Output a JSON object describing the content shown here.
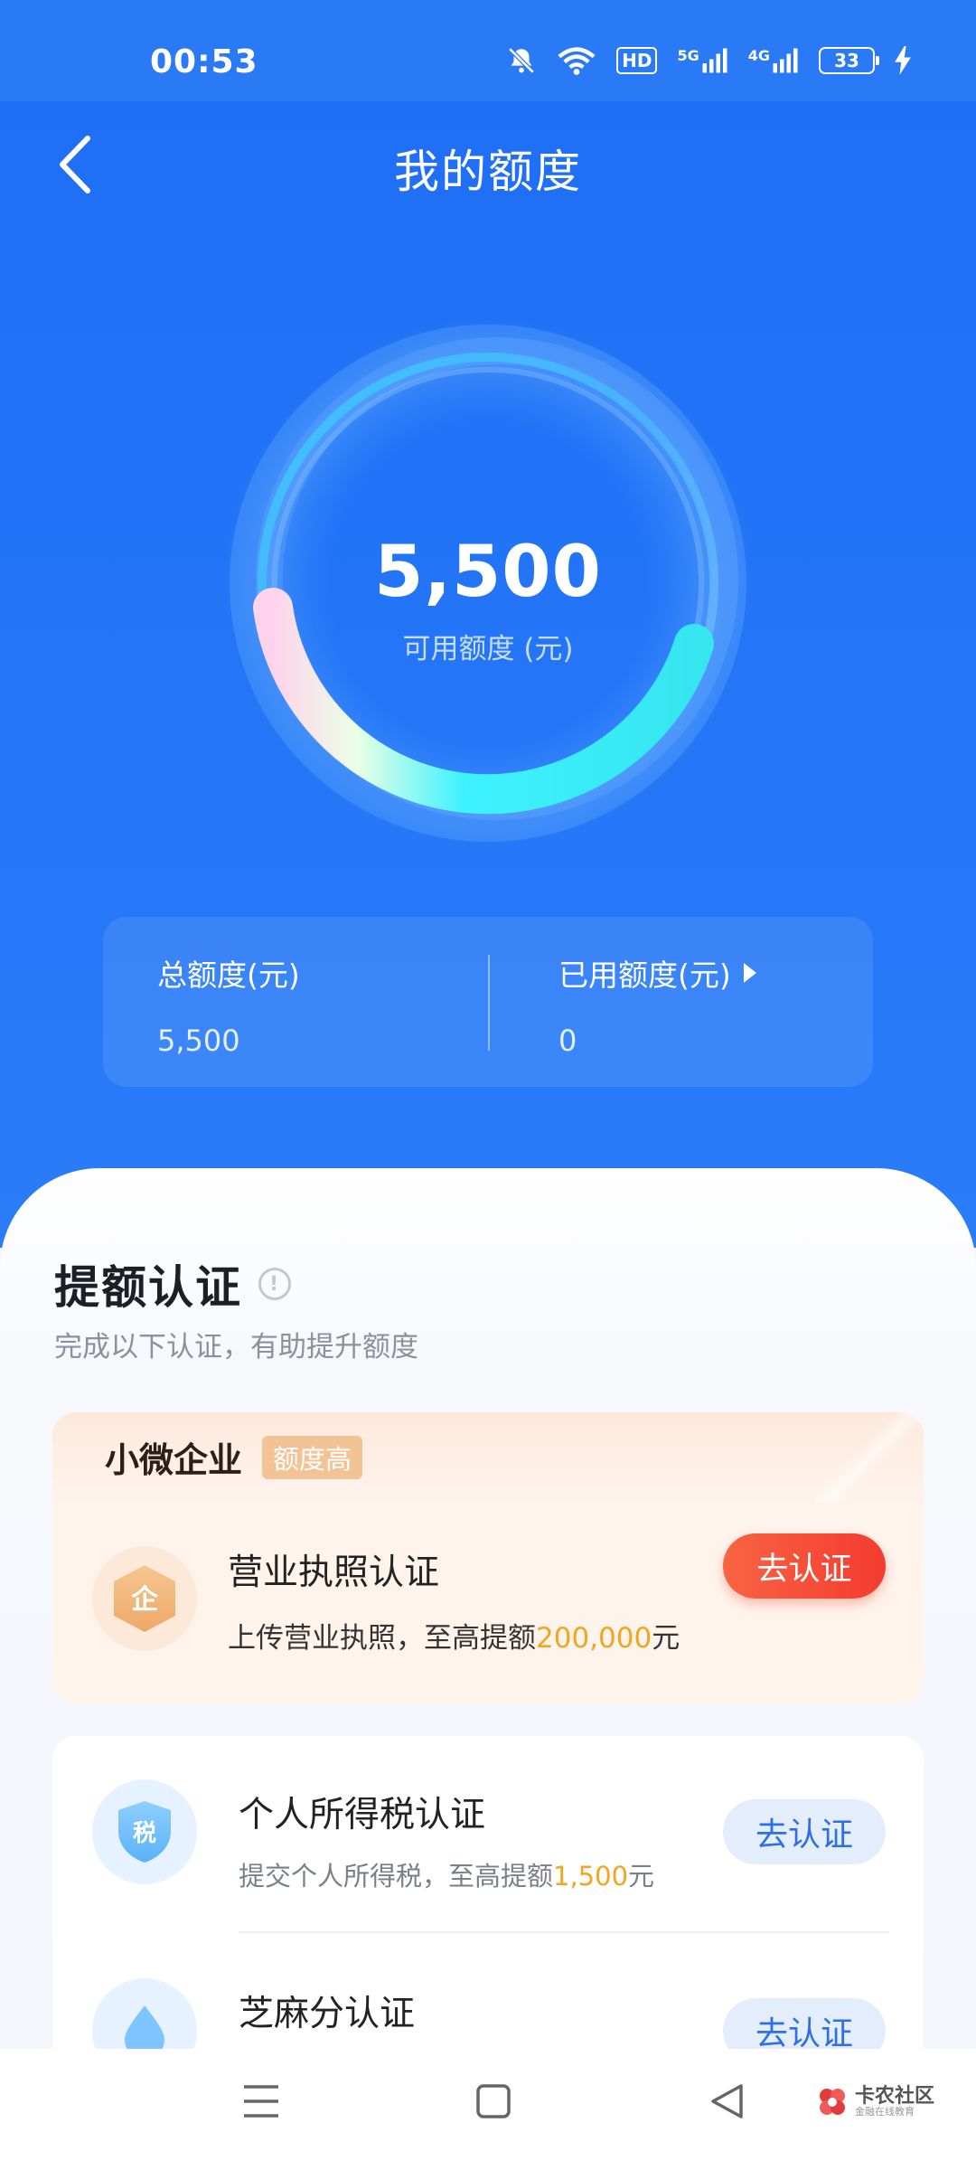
{
  "status_bar": {
    "time": "00:53",
    "hd_label": "HD",
    "sim1_label": "5G",
    "sim2_label": "4G",
    "battery": "33"
  },
  "header": {
    "title": "我的额度"
  },
  "ring": {
    "amount": "5,500",
    "caption": "可用额度 (元)"
  },
  "summary": {
    "total_label": "总额度(元)",
    "total_value": "5,500",
    "used_label": "已用额度(元)",
    "used_value": "0"
  },
  "certification": {
    "title": "提额认证",
    "subtitle": "完成以下认证，有助提升额度",
    "biz_section": {
      "title": "小微企业",
      "tag": "额度高",
      "item": {
        "icon_char": "企",
        "title": "营业执照认证",
        "desc_prefix": "上传营业执照，至高提额",
        "desc_amount": "200,000",
        "desc_suffix": "元",
        "button": "去认证"
      }
    },
    "items": [
      {
        "icon_char": "税",
        "title": "个人所得税认证",
        "desc_prefix": "提交个人所得税，至高提额",
        "desc_amount": "1,500",
        "desc_suffix": "元",
        "button": "去认证"
      },
      {
        "title": "芝麻分认证",
        "button": "去认证"
      }
    ]
  },
  "watermark": {
    "title": "卡农社区",
    "subtitle": "金融在线教育"
  },
  "colors": {
    "primary_blue": "#1e6ef5",
    "accent_orange": "#f3a521",
    "cta_red": "#f43b2f"
  }
}
